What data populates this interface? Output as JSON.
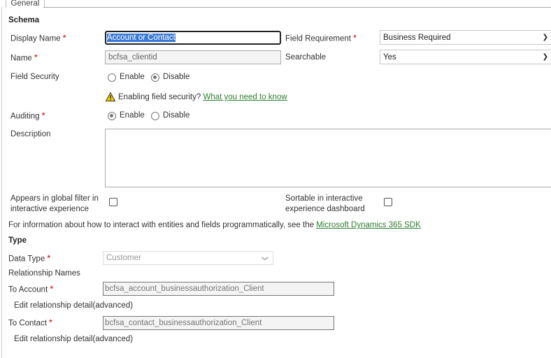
{
  "tabs": [
    {
      "label": "General"
    }
  ],
  "schema": {
    "heading": "Schema",
    "display_name": {
      "label": "Display Name",
      "value": "Account or Contact"
    },
    "name": {
      "label": "Name",
      "value": "bcfsa_clientid"
    },
    "field_requirement": {
      "label": "Field Requirement",
      "value": "Business Required"
    },
    "searchable": {
      "label": "Searchable",
      "value": "Yes"
    },
    "field_security": {
      "label": "Field Security",
      "enable": "Enable",
      "disable": "Disable",
      "selected": "Disable"
    },
    "warning": {
      "text": "Enabling field security?",
      "link": "What you need to know",
      "icon": "warning-icon"
    },
    "auditing": {
      "label": "Auditing",
      "enable": "Enable",
      "disable": "Disable",
      "selected": "Enable"
    },
    "description": {
      "label": "Description",
      "value": ""
    },
    "global_filter": {
      "label_line1": "Appears in global filter in",
      "label_line2": "interactive experience",
      "checked": false
    },
    "sortable": {
      "label_line1": "Sortable in interactive",
      "label_line2": "experience dashboard",
      "checked": false
    },
    "info_text": "For information about how to interact with entities and fields programmatically, see the",
    "info_link": "Microsoft Dynamics 365 SDK"
  },
  "type": {
    "heading": "Type",
    "data_type": {
      "label": "Data Type",
      "value": "Customer"
    },
    "relationship_names": "Relationship Names",
    "to_account": {
      "label": "To Account",
      "value": "bcfsa_account_businessauthorization_Client",
      "edit": "Edit relationship detail(advanced)"
    },
    "to_contact": {
      "label": "To Contact",
      "value": "bcfsa_contact_businessauthorization_Client",
      "edit": "Edit relationship detail(advanced)"
    }
  },
  "required_marker": "*",
  "colors": {
    "link": "#2e7d32",
    "required": "#cc0000",
    "selection": "#3a7bd5"
  }
}
